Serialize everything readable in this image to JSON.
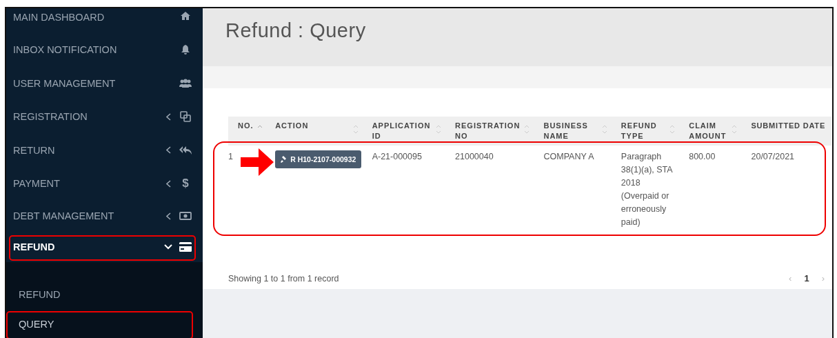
{
  "sidebar": {
    "items": [
      {
        "label": "MAIN DASHBOARD",
        "kind": "home",
        "has_submenu": false,
        "selected": false,
        "highlighted": false
      },
      {
        "label": "INBOX NOTIFICATION",
        "kind": "bell",
        "has_submenu": false,
        "selected": false,
        "highlighted": false
      },
      {
        "label": "USER MANAGEMENT",
        "kind": "users",
        "has_submenu": false,
        "selected": false,
        "highlighted": false
      },
      {
        "label": "REGISTRATION",
        "kind": "copy",
        "has_submenu": true,
        "selected": false,
        "expanded": false,
        "highlighted": false
      },
      {
        "label": "RETURN",
        "kind": "reply",
        "has_submenu": true,
        "selected": false,
        "expanded": false,
        "highlighted": false
      },
      {
        "label": "PAYMENT",
        "kind": "glyph",
        "glyph": "$",
        "has_submenu": true,
        "selected": false,
        "expanded": false,
        "highlighted": false
      },
      {
        "label": "DEBT MANAGEMENT",
        "kind": "money",
        "has_submenu": true,
        "selected": false,
        "expanded": false,
        "highlighted": false
      },
      {
        "label": "REFUND",
        "kind": "card",
        "has_submenu": true,
        "selected": true,
        "expanded": true,
        "highlighted": true,
        "children": [
          {
            "label": "REFUND",
            "selected": false,
            "highlighted": false
          },
          {
            "label": "QUERY",
            "selected": true,
            "highlighted": true
          }
        ]
      }
    ]
  },
  "page": {
    "title": "Refund : Query"
  },
  "table": {
    "columns": [
      {
        "label": "NO.",
        "sorted": true
      },
      {
        "label": "ACTION",
        "sorted": false
      },
      {
        "label": "APPLICATION ID",
        "sorted": false
      },
      {
        "label": "REGISTRATION NO",
        "sorted": false
      },
      {
        "label": "BUSINESS NAME",
        "sorted": false
      },
      {
        "label": "REFUND TYPE",
        "sorted": false
      },
      {
        "label": "CLAIM AMOUNT",
        "sorted": false
      },
      {
        "label": "SUBMITTED DATE"
      }
    ],
    "rows": [
      {
        "no": "1",
        "action": "R H10-2107-000932",
        "application_id": "A-21-000095",
        "registration_no": "21000040",
        "business_name": "COMPANY A",
        "refund_type": "Paragraph 38(1)(a), STA 2018 (Overpaid or erroneously paid)",
        "claim_amount": "800.00",
        "submitted_date": "20/07/2021",
        "highlighted": true,
        "pointer_arrow": true
      }
    ],
    "summary": "Showing 1 to 1 from 1 record",
    "pagination": {
      "prev": "‹",
      "pages": [
        {
          "label": "1",
          "selected": true
        }
      ],
      "next": "›"
    }
  }
}
